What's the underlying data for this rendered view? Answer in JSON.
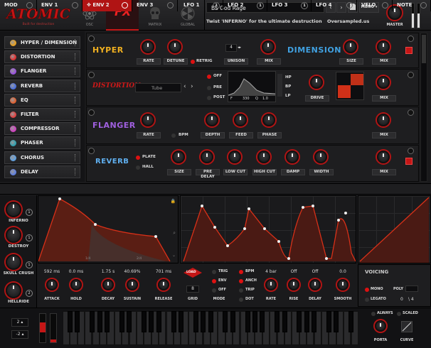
{
  "header": {
    "logo": "ATOMIC",
    "logo_sub": "Built for destruction",
    "tabs": [
      {
        "label": "OSC",
        "active": false
      },
      {
        "label": "FX",
        "active": true
      },
      {
        "label": "MATRIX",
        "active": false
      },
      {
        "label": "GLOBAL",
        "active": false
      }
    ],
    "preset_name": "BS God Rage",
    "preset_desc": "Twist 'INFERNO' for the ultimate destruction",
    "site": "Oversampled.us",
    "menu_label": "MENU",
    "master_label": "MASTER"
  },
  "sidebar": {
    "items": [
      {
        "label": "HYPER / DIMENSION",
        "color": "#e8a020"
      },
      {
        "label": "DISTORTION",
        "color": "#e03030"
      },
      {
        "label": "FLANGER",
        "color": "#9a50e0"
      },
      {
        "label": "REVERB",
        "color": "#4a70e0"
      },
      {
        "label": "EQ",
        "color": "#e06030"
      },
      {
        "label": "FILTER",
        "color": "#e04040"
      },
      {
        "label": "COMPRESSOR",
        "color": "#d040c0"
      },
      {
        "label": "PHASER",
        "color": "#30a0b0"
      },
      {
        "label": "CHORUS",
        "color": "#60a0e0"
      },
      {
        "label": "DELAY",
        "color": "#6080e0"
      }
    ]
  },
  "fx": {
    "hyper": {
      "name": "HYPER",
      "rate": "RATE",
      "detune": "DETUNE",
      "retrig": "RETRIG",
      "unison": "UNISON",
      "unison_value": "4",
      "mix": "MIX"
    },
    "dimension": {
      "name": "DIMENSION",
      "size": "SIZE",
      "mix": "MIX"
    },
    "distortion": {
      "name": "DISTORTION",
      "type": "Tube",
      "off": "OFF",
      "pre": "PRE",
      "post": "POST",
      "freq": "330",
      "q": "1.0",
      "hp": "HP",
      "bp": "BP",
      "lp": "LP",
      "drive": "DRIVE",
      "f_lbl": "F",
      "q_lbl": "Q",
      "mix": "MIX"
    },
    "flanger": {
      "name": "FLANGER",
      "rate": "RATE",
      "bpm": "BPM",
      "depth": "DEPTH",
      "feed": "FEED",
      "phase": "PHASE",
      "mix": "MIX"
    },
    "reverb": {
      "name": "REVERB",
      "plate": "PLATE",
      "hall": "HALL",
      "size": "SIZE",
      "predelay": "PRE DELAY",
      "lowcut": "LOW CUT",
      "highcut": "HIGH CUT",
      "damp": "DAMP",
      "width": "WIDTH",
      "mix": "MIX"
    }
  },
  "mod": {
    "tabs": {
      "mod": "MOD",
      "env1": "ENV 1",
      "env2": "ENV 2",
      "env3": "ENV 3",
      "lfo1": "LFO 1",
      "lfo1n": "2",
      "lfo2": "LFO 2",
      "lfo2n": "1",
      "lfo3": "LFO 3",
      "lfo3n": "1",
      "lfo4": "LFO 4",
      "velo": "VELO",
      "note": "NOTE"
    },
    "macros": [
      {
        "label": "INFERNO",
        "num": "1"
      },
      {
        "label": "DESTROY",
        "num": "1"
      },
      {
        "label": "SKULL CRUSH",
        "num": "1"
      },
      {
        "label": "HELLRIDE",
        "num": "2"
      }
    ],
    "env": {
      "attack": {
        "label": "ATTACK",
        "value": "592 ms"
      },
      "hold": {
        "label": "HOLD",
        "value": "0.0 ms"
      },
      "decay": {
        "label": "DECAY",
        "value": "1.75 s"
      },
      "sustain": {
        "label": "SUSTAIN",
        "value": "40.69%"
      },
      "release": {
        "label": "RELEASE",
        "value": "701 ms"
      },
      "marker1": "1/4",
      "marker2": "2/4"
    },
    "lfo": {
      "load": "LOAD",
      "grid": "GRID",
      "grid_value": "8",
      "mode": "MODE",
      "trig": "TRIG",
      "env": "ENV",
      "off": "OFF",
      "bpm": "BPM",
      "anch": "ANCH",
      "trip": "TRIP",
      "dot": "DOT",
      "rate": {
        "label": "RATE",
        "value": "4 bar"
      },
      "rise": {
        "label": "RISE",
        "value": "Off"
      },
      "delay": {
        "label": "DELAY",
        "value": "Off"
      },
      "smooth": {
        "label": "SMOOTH",
        "value": "0.0"
      }
    },
    "voicing": {
      "title": "VOICING",
      "mono": "MONO",
      "poly": "POLY",
      "legato": "LEGATO",
      "legato_value": "0",
      "legato_div": "\\ 4"
    }
  },
  "keyboard": {
    "oct_up": "2",
    "oct_down": "-2",
    "always": "ALWAYS",
    "scaled": "SCALED",
    "porta": "PORTA",
    "curve": "CURVE"
  },
  "colors": {
    "accent": "#c51616",
    "bg": "#1a1a1c"
  }
}
